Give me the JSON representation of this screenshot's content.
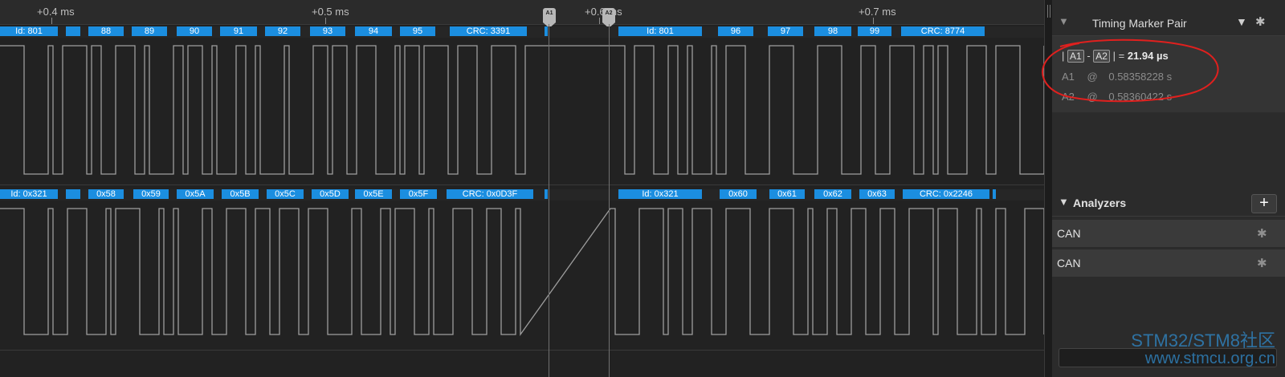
{
  "ruler": {
    "ticks": [
      "+0.4 ms",
      "+0.5 ms",
      "+0.6 ms",
      "+0.7 ms"
    ]
  },
  "markers": {
    "a1": "A1",
    "a2": "A2"
  },
  "decoders": {
    "row1": [
      "Id: 801",
      "88",
      "89",
      "90",
      "91",
      "92",
      "93",
      "94",
      "95",
      "CRC: 3391",
      "Id: 801",
      "96",
      "97",
      "98",
      "99",
      "CRC: 8774"
    ],
    "row2": [
      "Id: 0x321",
      "0x58",
      "0x59",
      "0x5A",
      "0x5B",
      "0x5C",
      "0x5D",
      "0x5E",
      "0x5F",
      "CRC: 0x0D3F",
      "Id: 0x321",
      "0x60",
      "0x61",
      "0x62",
      "0x63",
      "CRC: 0x2246"
    ]
  },
  "timing": {
    "title": "Timing Marker Pair",
    "pipe": "|",
    "dash": "-",
    "eq": "| =",
    "delta": "21.94 µs",
    "a1_at": "@",
    "a1_time": "0.58358228 s",
    "a2_time": "0.58360422 s"
  },
  "analyzers": {
    "title": "Analyzers",
    "items": [
      "CAN",
      "CAN"
    ]
  },
  "icons": {
    "pin": "pin-icon",
    "collapse": "triangle-down-icon",
    "gear": "gear-icon",
    "add": "plus-icon"
  },
  "watermark": {
    "line1": "STM32/STM8社区",
    "line2": "www.stmcu.org.cn"
  },
  "colors": {
    "decode_box": "#1b8ee0",
    "signal": "#9e9e9e",
    "annotation": "#e0201e"
  }
}
